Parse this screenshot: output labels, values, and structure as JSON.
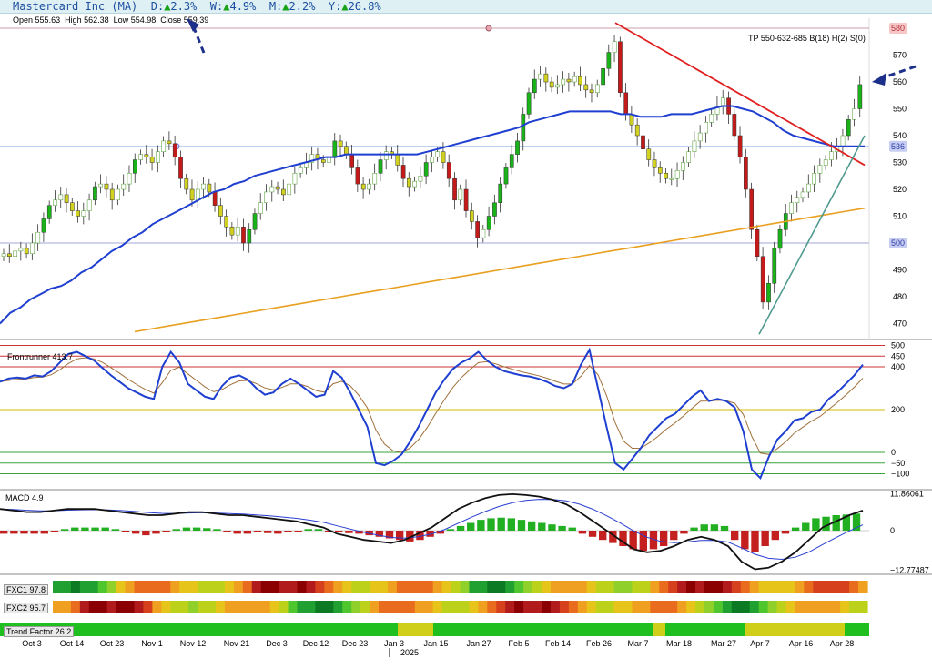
{
  "header": {
    "company": "Mastercard Inc (MA)",
    "d_label": "D:",
    "d_value": "2.3%",
    "w_label": "W:",
    "w_value": "4.9%",
    "m_label": "M:",
    "m_value": "2.2%",
    "y_label": "Y:",
    "y_value": "26.8%",
    "up_arrow": "▲"
  },
  "ohlc": {
    "open_label": "Open",
    "open": "555.63",
    "high_label": "High",
    "high": "562.38",
    "low_label": "Low",
    "low": "554.98",
    "close_label": "Close",
    "close": "559.39"
  },
  "tp_text": "TP 550-632-685 B(18) H(2) S(0)",
  "chart_data": {
    "type": "candlestick",
    "price_axis": {
      "ticks": [
        470,
        480,
        490,
        500,
        510,
        520,
        530,
        540,
        550,
        560,
        570
      ],
      "range": [
        465,
        583
      ]
    },
    "price_badges": [
      {
        "value": "580",
        "color": "#f7c7c7",
        "text_color": "#b0303a"
      },
      {
        "value": "536",
        "color": "#c7cdf2",
        "text_color": "#2b3ca3"
      },
      {
        "value": "500",
        "color": "#c7cdf2",
        "text_color": "#2b3ca3"
      }
    ],
    "horizontal_levels": [
      {
        "value": 580,
        "color": "#c9a2aa"
      },
      {
        "value": 536,
        "color": "#a9c3ea"
      },
      {
        "value": 500,
        "color": "#a3a6d8"
      }
    ],
    "closes": [
      496,
      495,
      497,
      498,
      496,
      500,
      504,
      509,
      514,
      516,
      518,
      515,
      512,
      510,
      512,
      516,
      521,
      522,
      520,
      516,
      520,
      522,
      526,
      531,
      533,
      532,
      530,
      534,
      538,
      537,
      532,
      524,
      520,
      516,
      520,
      522,
      519,
      514,
      510,
      506,
      503,
      506,
      500,
      505,
      511,
      515,
      519,
      521,
      520,
      518,
      522,
      526,
      528,
      530,
      533,
      531,
      530,
      532,
      538,
      536,
      533,
      528,
      522,
      520,
      522,
      526,
      531,
      534,
      533,
      529,
      524,
      521,
      523,
      525,
      530,
      532,
      534,
      530,
      524,
      516,
      520,
      512,
      508,
      502,
      505,
      510,
      515,
      522,
      528,
      533,
      538,
      548,
      556,
      561,
      563,
      560,
      558,
      559,
      561,
      560,
      562,
      559,
      557,
      556,
      559,
      565,
      571,
      575,
      556,
      548,
      544,
      540,
      535,
      531,
      528,
      526,
      524,
      524,
      527,
      530,
      534,
      538,
      541,
      545,
      548,
      551,
      554,
      548,
      540,
      532,
      520,
      505,
      495,
      478,
      485,
      498,
      505,
      511,
      515,
      517,
      519,
      522,
      526,
      529,
      531,
      534,
      536,
      540,
      546,
      550,
      559
    ],
    "sma50": {
      "start": 535,
      "points": [
        340,
        318,
        308,
        298,
        290,
        283,
        277,
        268,
        259,
        250,
        240,
        232,
        223,
        213,
        205,
        196,
        189,
        182,
        175,
        167,
        160,
        153,
        146,
        140,
        134,
        128,
        121,
        117,
        111,
        105,
        98,
        92,
        88,
        84,
        79,
        76,
        71,
        66,
        59,
        52,
        48,
        43,
        38,
        34,
        29,
        27,
        24,
        22,
        19,
        16,
        12,
        8,
        1,
        -4,
        -10,
        -15,
        -21,
        -27,
        -32,
        -37,
        -40,
        -45,
        -46,
        -45,
        -43,
        -41,
        -38,
        -34,
        -31,
        -27,
        -24,
        -20,
        -14,
        -8,
        -3,
        2,
        8,
        14,
        19,
        24,
        27,
        28,
        29,
        30,
        31,
        32,
        33,
        34
      ]
    },
    "sma200": {
      "start": 528,
      "end": 513
    },
    "candle_colors": {
      "up_strong": "#19b319",
      "down_strong": "#c41a1a",
      "up_weak": "#d1d21f",
      "neutral": "#9bd45b"
    }
  },
  "frontrunner": {
    "label": "Frontrunner 413.7",
    "ticks": [
      "500",
      "450",
      "400",
      "200",
      "0",
      "−50",
      "−100"
    ],
    "tick_values": [
      500,
      450,
      400,
      200,
      0,
      -50,
      -100
    ]
  },
  "macd": {
    "label": "MACD 4.9",
    "ticks": [
      "11.86061",
      "0",
      "−12.77487"
    ],
    "tick_values": [
      11.86061,
      0,
      -12.77487
    ]
  },
  "strips": {
    "fxc1": "FXC1 97.8",
    "fxc2": "FXC2 95.7",
    "trend": "Trend Factor 26.2"
  },
  "x_axis": {
    "labels": [
      "Oct 3",
      "Oct 14",
      "Oct 23",
      "Nov 1",
      "Nov 12",
      "Nov 21",
      "Dec 3",
      "Dec 12",
      "Dec 23",
      "Jan 3",
      "Jan 15",
      "Jan 27",
      "Feb 5",
      "Feb 14",
      "Feb 26",
      "Mar 7",
      "Mar 18",
      "Mar 27",
      "Apr 7",
      "Apr 16",
      "Apr 28"
    ],
    "year": "2025"
  }
}
